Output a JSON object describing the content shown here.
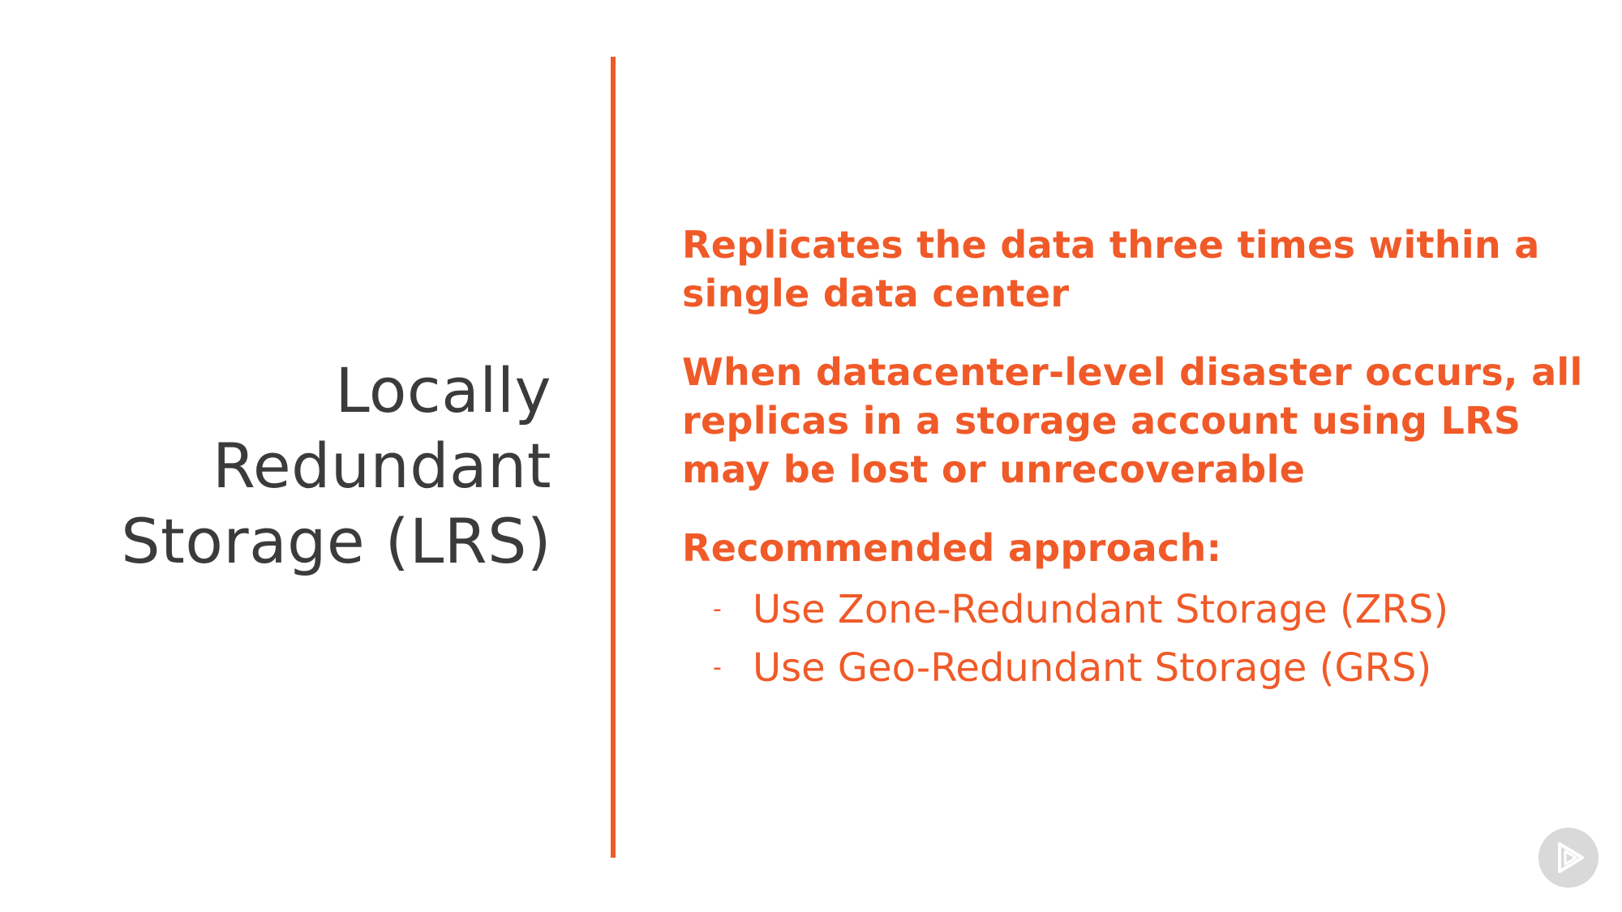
{
  "slide": {
    "title_lines": [
      "Locally",
      "Redundant",
      "Storage (LRS)"
    ],
    "points": [
      "Replicates the data three times within a single data center",
      "When datacenter-level disaster occurs, all replicas in a storage account using LRS may be lost or unrecoverable"
    ],
    "recommended": {
      "heading": "Recommended approach:",
      "items": [
        "Use Zone-Redundant Storage (ZRS)",
        "Use Geo-Redundant Storage (GRS)"
      ],
      "bullet": "-"
    }
  },
  "colors": {
    "accent": "#f05a28",
    "title_text": "#3b3b3b",
    "background": "#ffffff",
    "logo_bg": "#d9d9d9"
  },
  "icons": {
    "logo": "play-logo-icon"
  }
}
